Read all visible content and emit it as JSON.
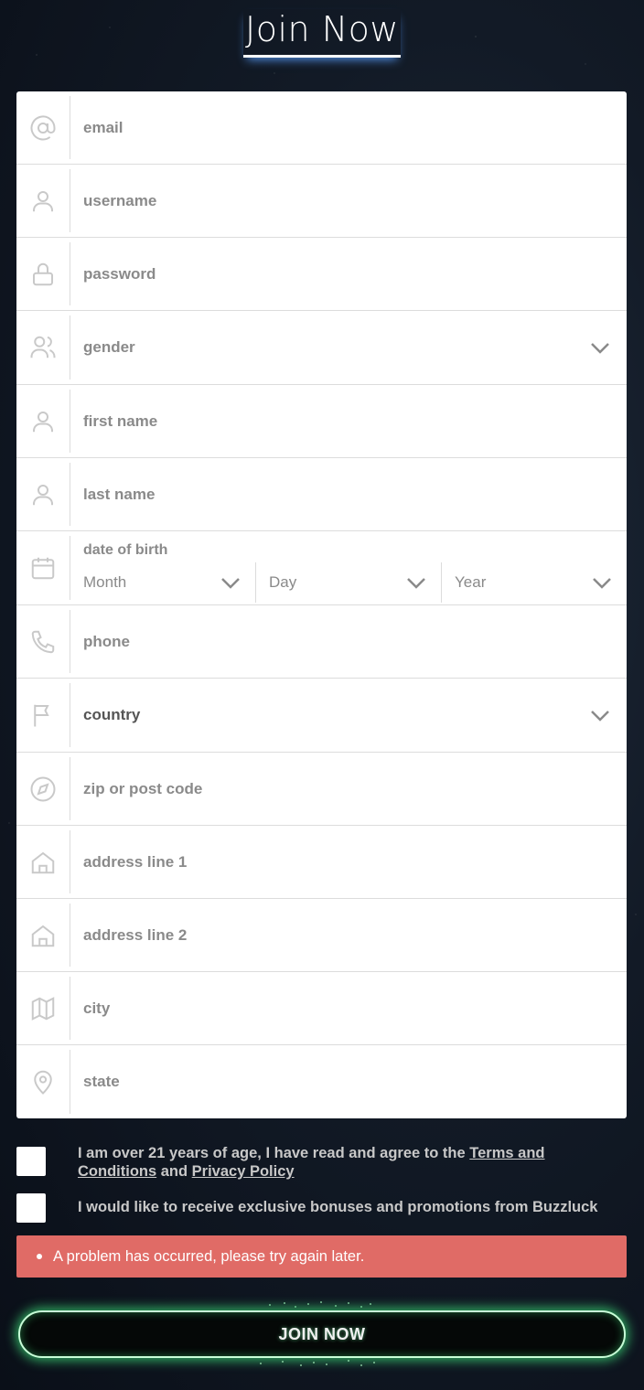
{
  "header": {
    "title": "Join Now"
  },
  "form": {
    "email": {
      "placeholder": "email",
      "icon": "at-icon"
    },
    "username": {
      "placeholder": "username",
      "icon": "user-icon"
    },
    "password": {
      "placeholder": "password",
      "icon": "lock-icon"
    },
    "gender": {
      "placeholder": "gender",
      "icon": "users-icon"
    },
    "first_name": {
      "placeholder": "first name",
      "icon": "user-icon"
    },
    "last_name": {
      "placeholder": "last name",
      "icon": "user-icon"
    },
    "dob": {
      "label": "date of birth",
      "month": "Month",
      "day": "Day",
      "year": "Year",
      "icon": "calendar-icon"
    },
    "phone": {
      "placeholder": "phone",
      "icon": "phone-icon"
    },
    "country": {
      "placeholder": "country",
      "icon": "flag-icon"
    },
    "zip": {
      "placeholder": "zip or post code",
      "icon": "compass-icon"
    },
    "address1": {
      "placeholder": "address line 1",
      "icon": "home-icon"
    },
    "address2": {
      "placeholder": "address line 2",
      "icon": "home-icon"
    },
    "city": {
      "placeholder": "city",
      "icon": "map-icon"
    },
    "state": {
      "placeholder": "state",
      "icon": "map-pin-icon"
    }
  },
  "agreements": {
    "age_text_1": "I am over 21 years of age, I have read and agree to the ",
    "terms_link": "Terms and Conditions",
    "age_text_2": " and ",
    "privacy_link": "Privacy Policy",
    "promo_text": "I would like to receive exclusive bonuses and promotions from Buzzluck"
  },
  "error": {
    "message": "A problem has occurred, please try again later."
  },
  "submit": {
    "label": "JOIN NOW"
  },
  "colors": {
    "error_bg": "#e06b66",
    "button_glow": "#3cdc78",
    "background": "#121a26"
  }
}
